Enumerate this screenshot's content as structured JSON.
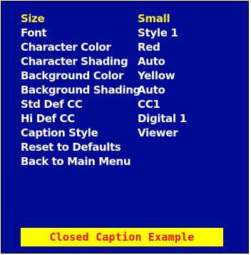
{
  "colors": {
    "background": "#000b94",
    "text": "#ffffff",
    "selected_text": "#ffec3a",
    "example_background": "#ffff00",
    "example_text": "#ff0000"
  },
  "menu": {
    "selected_index": 0,
    "items": [
      {
        "label": "Size",
        "value": "Small"
      },
      {
        "label": "Font",
        "value": "Style 1"
      },
      {
        "label": "Character Color",
        "value": "Red"
      },
      {
        "label": "Character Shading",
        "value": "Auto"
      },
      {
        "label": "Background Color",
        "value": "Yellow"
      },
      {
        "label": "Background Shading",
        "value": "Auto"
      },
      {
        "label": "Std Def CC",
        "value": "CC1"
      },
      {
        "label": "Hi Def CC",
        "value": "Digital 1"
      },
      {
        "label": "Caption Style",
        "value": "Viewer"
      },
      {
        "label": "Reset to Defaults",
        "value": ""
      },
      {
        "label": "Back to Main Menu",
        "value": ""
      }
    ]
  },
  "example": {
    "text": "Closed Caption Example"
  }
}
